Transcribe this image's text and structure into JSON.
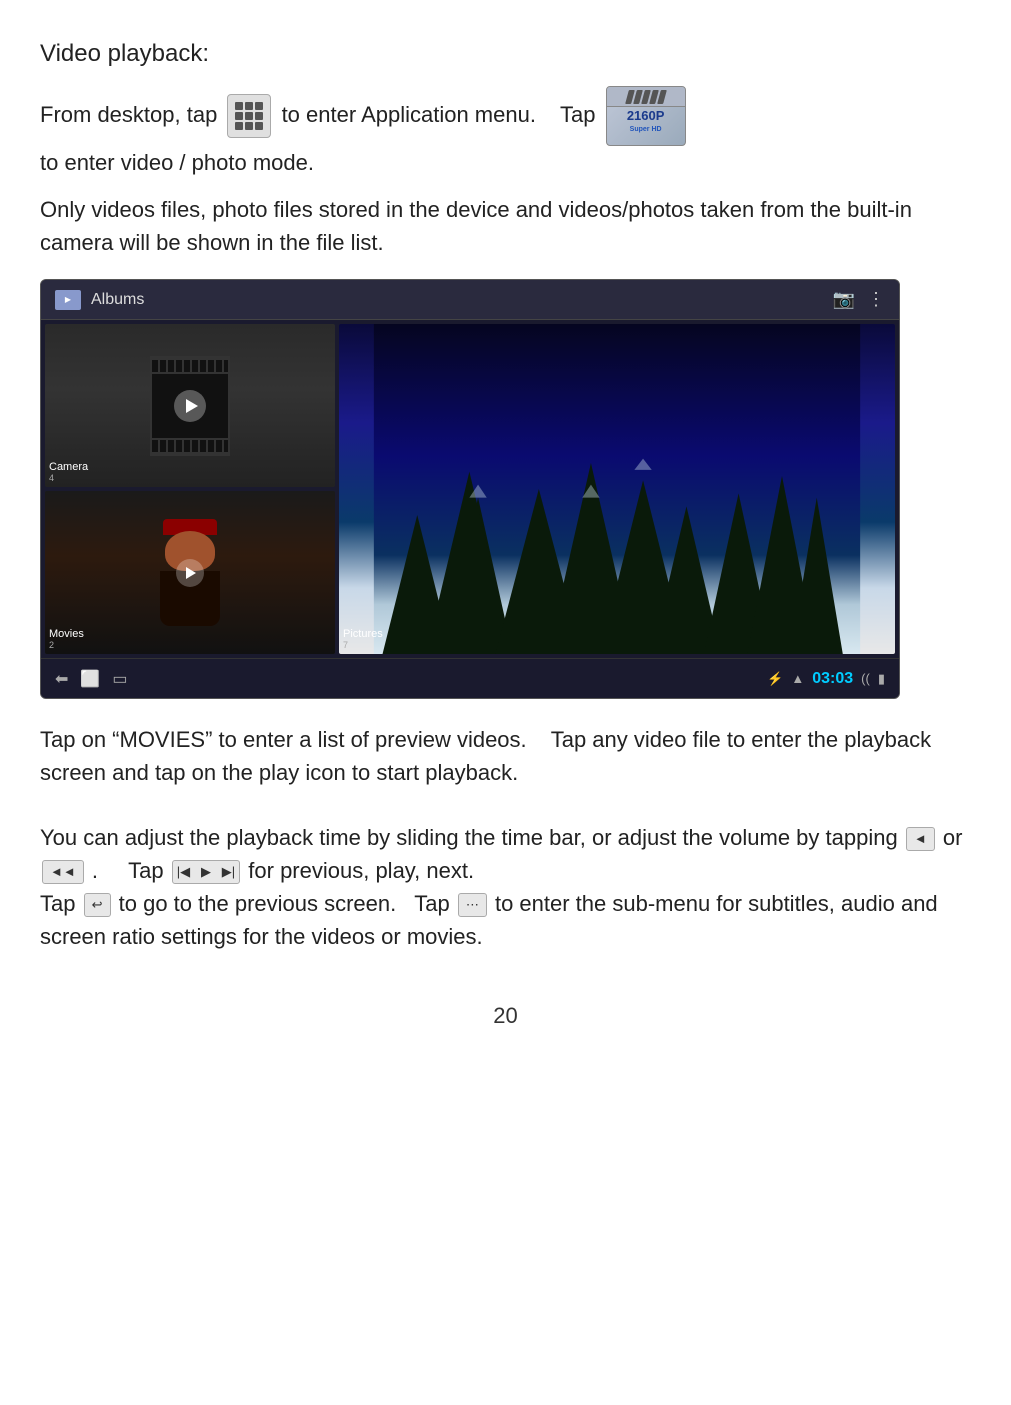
{
  "page": {
    "number": "20",
    "title": "Video playback:"
  },
  "content": {
    "para1_before": "From desktop, tap",
    "para1_after": "to enter Application menu.",
    "para1_tap": "Tap",
    "para1_end": "to enter video / photo mode.",
    "para2": "Only videos files, photo files stored in the device and videos/photos taken from the built-in camera will be shown in the file list.",
    "para3_before": "Tap on “MOVIES” to enter a list of preview videos.",
    "para3_after": "Tap any video file to enter the playback screen and tap on the play icon to start playback.",
    "para4_line1_before": "You can adjust the playback time by sliding the time bar, or adjust the volume by tapping",
    "para4_line1_or": "or",
    "para4_line1_tap": "Tap",
    "para4_line1_for": "for previous, play, next.",
    "para4_line2_before": "Tap",
    "para4_line2_mid": "to go to the previous screen.",
    "para4_line2_tap2": "Tap",
    "para4_line2_end": "to enter the sub-menu for subtitles, audio and screen ratio settings for the videos or movies."
  },
  "album_screen": {
    "title": "Albums",
    "camera_label": "Camera",
    "camera_count": "4",
    "pictures_label": "Pictures",
    "pictures_count": "7",
    "movies_label": "Movies",
    "movies_count": "2",
    "time": "03:03"
  },
  "icons": {
    "grid_icon": "⊞",
    "prev_icon": "◀",
    "next_icon": "▶",
    "play_prev": "⏮",
    "play_next": "⏭",
    "back_icon": "⬅",
    "menu_icon": "⋮",
    "camera_icon": "📷"
  }
}
